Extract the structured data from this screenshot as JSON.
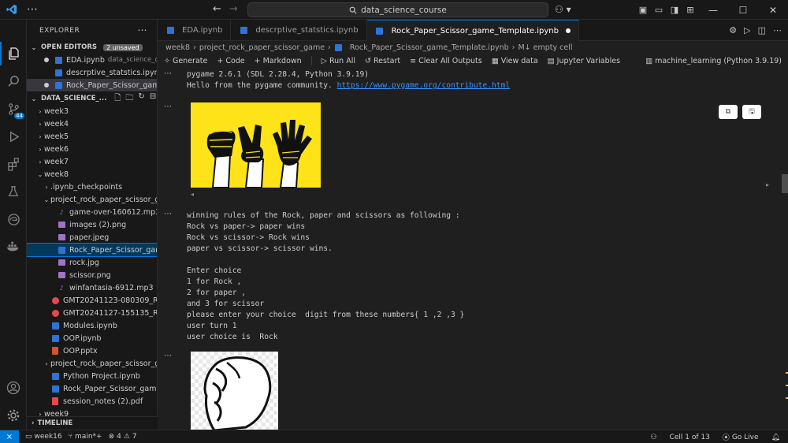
{
  "titlebar": {
    "search": "data_science_course"
  },
  "sidebar": {
    "title": "EXPLORER",
    "open_editors_label": "OPEN EDITORS",
    "unsaved_badge": "2 unsaved",
    "open_editors": [
      {
        "name": "EDA.ipynb",
        "desc": "data_science_di..."
      },
      {
        "name": "descrptive_statstics.ipynb",
        "desc": ""
      },
      {
        "name": "Rock_Paper_Scissor_gam...",
        "desc": ""
      }
    ],
    "workspace_label": "DATA_SCIENCE_...",
    "tree": [
      {
        "label": "week3",
        "type": "folder",
        "depth": 0,
        "chev": "›"
      },
      {
        "label": "week4",
        "type": "folder",
        "depth": 0,
        "chev": "›"
      },
      {
        "label": "week5",
        "type": "folder",
        "depth": 0,
        "chev": "›"
      },
      {
        "label": "week6",
        "type": "folder",
        "depth": 0,
        "chev": "›"
      },
      {
        "label": "week7",
        "type": "folder",
        "depth": 0,
        "chev": "›"
      },
      {
        "label": "week8",
        "type": "folder",
        "depth": 0,
        "chev": "⌄"
      },
      {
        "label": ".ipynb_checkpoints",
        "type": "folder",
        "depth": 1,
        "chev": "›"
      },
      {
        "label": "project_rock_paper_scissor_g...",
        "type": "folder",
        "depth": 1,
        "chev": "⌄"
      },
      {
        "label": "game-over-160612.mp3",
        "type": "mp3",
        "depth": 2
      },
      {
        "label": "images (2).png",
        "type": "img",
        "depth": 2
      },
      {
        "label": "paper.jpeg",
        "type": "img",
        "depth": 2
      },
      {
        "label": "Rock_Paper_Scissor_game_T...",
        "type": "nb",
        "depth": 2,
        "selected": true
      },
      {
        "label": "rock.jpg",
        "type": "img",
        "depth": 2
      },
      {
        "label": "scissor.png",
        "type": "img",
        "depth": 2
      },
      {
        "label": "winfantasia-6912.mp3",
        "type": "mp3",
        "depth": 2
      },
      {
        "label": "GMT20241123-080309_Recor...",
        "type": "rec",
        "depth": 1
      },
      {
        "label": "GMT20241127-155135_Recor...",
        "type": "rec",
        "depth": 1
      },
      {
        "label": "Modules.ipynb",
        "type": "nb",
        "depth": 1
      },
      {
        "label": "OOP.ipynb",
        "type": "nb",
        "depth": 1
      },
      {
        "label": "OOP.pptx",
        "type": "pptx",
        "depth": 1
      },
      {
        "label": "project_rock_paper_scissor_g...",
        "type": "folder",
        "depth": 1,
        "chev": "›"
      },
      {
        "label": "Python Project.ipynb",
        "type": "nb",
        "depth": 1
      },
      {
        "label": "Rock_Paper_Scissor_game_Te...",
        "type": "nb",
        "depth": 1
      },
      {
        "label": "session_notes (2).pdf",
        "type": "pdf",
        "depth": 1
      },
      {
        "label": "week9",
        "type": "folder",
        "depth": 0,
        "chev": "›"
      }
    ],
    "timeline_label": "TIMELINE"
  },
  "tabs": [
    {
      "label": "EDA.ipynb",
      "active": false
    },
    {
      "label": "descrptive_statstics.ipynb",
      "active": false
    },
    {
      "label": "Rock_Paper_Scissor_game_Template.ipynb",
      "active": true
    }
  ],
  "breadcrumb": [
    "week8",
    "project_rock_paper_scissor_game",
    "Rock_Paper_Scissor_game_Template.ipynb",
    "M↓ empty cell"
  ],
  "toolbar": {
    "generate": "Generate",
    "code": "Code",
    "markdown": "Markdown",
    "run_all": "Run All",
    "restart": "Restart",
    "clear_outputs": "Clear All Outputs",
    "view_data": "View data",
    "jupyter_vars": "Jupyter Variables",
    "kernel": "machine_learning (Python 3.9.19)"
  },
  "output": {
    "pygame_line1": "pygame 2.6.1 (SDL 2.28.4, Python 3.9.19)",
    "pygame_line2_prefix": "Hello from the pygame community. ",
    "pygame_link": "https://www.pygame.org/contribute.html",
    "game_text": "winning rules of the Rock, paper and scissors as following :\nRock vs paper-> paper wins\nRock vs scissor-> Rock wins\npaper vs scissor-> scissor wins.\n\nEnter choice\n1 for Rock ,\n2 for paper ,\nand 3 for scissor\nplease enter your choice  digit from these numbers{ 1 ,2 ,3 }\nuser turn 1\nuser choice is  Rock"
  },
  "statusbar": {
    "branch_folder": "week16",
    "branch": "main*+",
    "errors": "4",
    "warnings": "7",
    "cell_position": "Cell 1 of 13",
    "go_live": "Go Live"
  }
}
